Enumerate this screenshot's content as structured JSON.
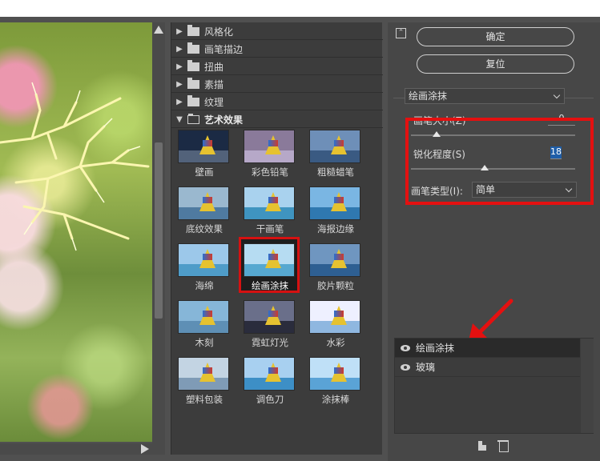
{
  "categories": [
    {
      "label": "风格化",
      "expanded": false
    },
    {
      "label": "画笔描边",
      "expanded": false
    },
    {
      "label": "扭曲",
      "expanded": false
    },
    {
      "label": "素描",
      "expanded": false
    },
    {
      "label": "纹理",
      "expanded": false
    },
    {
      "label": "艺术效果",
      "expanded": true
    }
  ],
  "filters": [
    "壁画",
    "彩色铅笔",
    "粗糙蜡笔",
    "底纹效果",
    "干画笔",
    "海报边缘",
    "海绵",
    "绘画涂抹",
    "胶片颗粒",
    "木刻",
    "霓虹灯光",
    "水彩",
    "塑料包装",
    "调色刀",
    "涂抹棒"
  ],
  "selected_filter": "绘画涂抹",
  "buttons": {
    "ok": "确定",
    "reset": "复位"
  },
  "filter_dropdown": "绘画涂抹",
  "params": {
    "brush_size_label": "画笔大小(Z)",
    "brush_size_value": "0",
    "sharpness_label": "锐化程度(S)",
    "sharpness_value": "18",
    "brush_type_label": "画笔类型(I):",
    "brush_type_value": "简单"
  },
  "layers": [
    "绘画涂抹",
    "玻璃"
  ],
  "colors": {
    "highlight": "#e41010",
    "selection": "#1f5ea8"
  }
}
